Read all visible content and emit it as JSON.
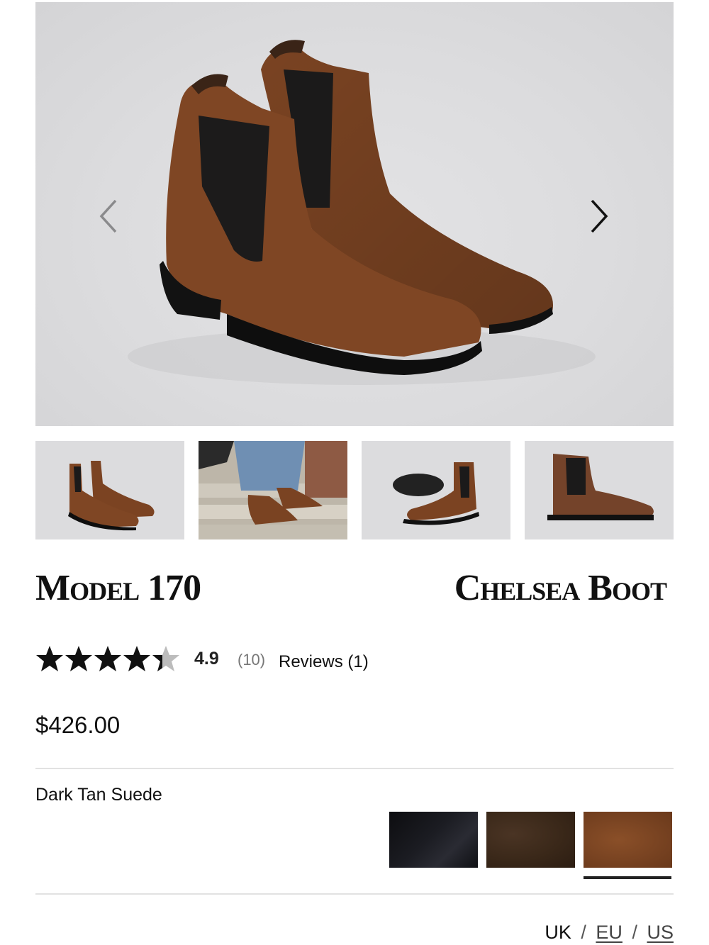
{
  "gallery": {
    "main_image": "dark-tan-suede-chelsea-boots-pair",
    "prev_icon": "chevron-left-icon",
    "next_icon": "chevron-right-icon",
    "thumbnails": [
      {
        "image": "boots-pair-front"
      },
      {
        "image": "boots-worn-on-steps"
      },
      {
        "image": "boot-sole-and-side"
      },
      {
        "image": "boot-side-profile"
      }
    ]
  },
  "product": {
    "model": "Model 170",
    "type": "Chelsea Boot",
    "price": "$426.00"
  },
  "rating": {
    "stars_value": 4.9,
    "stars_max": 5,
    "value_label": "4.9",
    "count_label": "(10)",
    "reviews_label": "Reviews (1)"
  },
  "color": {
    "selected_name": "Dark Tan Suede",
    "swatches": [
      {
        "name": "black",
        "hex": "#16171c"
      },
      {
        "name": "dark-brown",
        "hex": "#3a2819"
      },
      {
        "name": "dark-tan",
        "hex": "#7a4422",
        "selected": true
      }
    ]
  },
  "sizing": {
    "systems": [
      "UK",
      "EU",
      "US"
    ],
    "separator": "/"
  }
}
